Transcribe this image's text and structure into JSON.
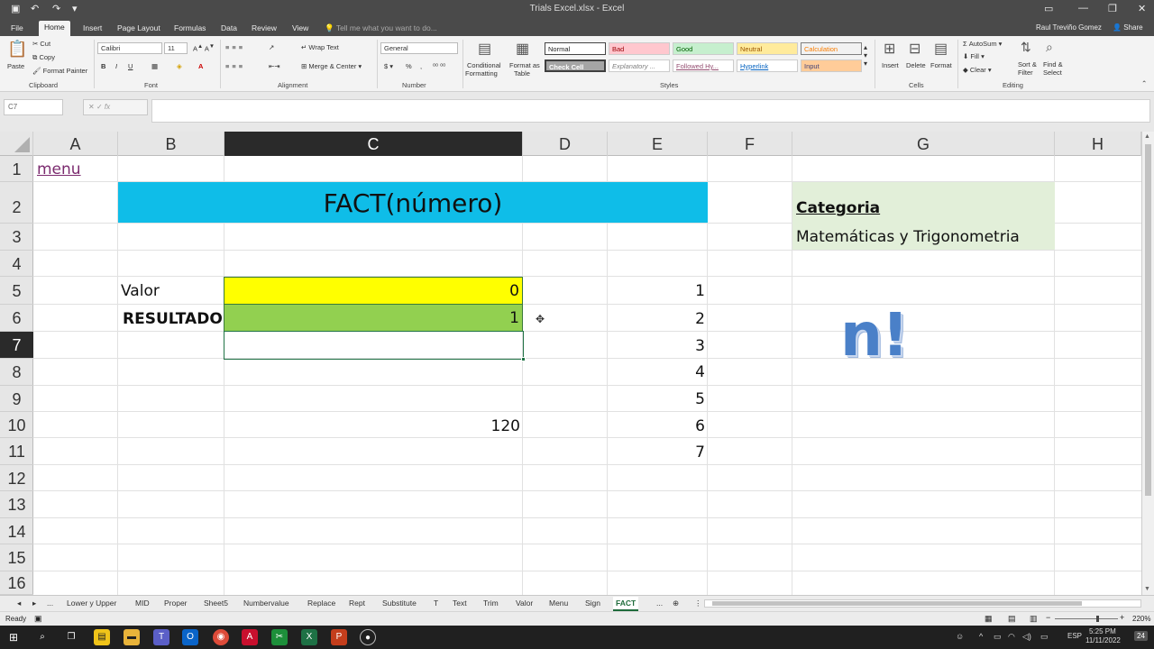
{
  "window": {
    "title": "Trials Excel.xlsx - Excel",
    "user": "Raul Treviño Gomez",
    "share": "Share"
  },
  "ribbon_tabs": [
    "File",
    "Home",
    "Insert",
    "Page Layout",
    "Formulas",
    "Data",
    "Review",
    "View"
  ],
  "tell_me": "Tell me what you want to do...",
  "ribbon": {
    "clipboard": {
      "paste": "Paste",
      "cut": "Cut",
      "copy": "Copy",
      "format_painter": "Format Painter",
      "label": "Clipboard"
    },
    "font": {
      "name": "Calibri",
      "size": "11",
      "label": "Font"
    },
    "alignment": {
      "wrap": "Wrap Text",
      "merge": "Merge & Center",
      "label": "Alignment"
    },
    "number": {
      "format": "General",
      "label": "Number"
    },
    "cond": {
      "line1": "Conditional",
      "line2": "Formatting"
    },
    "fmt_table": {
      "line1": "Format as",
      "line2": "Table"
    },
    "styles": {
      "normal": "Normal",
      "bad": "Bad",
      "good": "Good",
      "neutral": "Neutral",
      "calculation": "Calculation",
      "check": "Check Cell",
      "explanatory": "Explanatory ...",
      "followed": "Followed Hy...",
      "hyperlink": "Hyperlink",
      "input": "Input",
      "label": "Styles"
    },
    "cells": {
      "insert": "Insert",
      "delete": "Delete",
      "format": "Format",
      "label": "Cells"
    },
    "editing": {
      "autosum": "AutoSum",
      "fill": "Fill",
      "clear": "Clear",
      "sort1": "Sort &",
      "sort2": "Filter",
      "find1": "Find &",
      "find2": "Select",
      "label": "Editing"
    }
  },
  "namebox": "C7",
  "columns": [
    "A",
    "B",
    "C",
    "D",
    "E",
    "F",
    "G",
    "H"
  ],
  "rows": [
    "1",
    "2",
    "3",
    "4",
    "5",
    "6",
    "7",
    "8",
    "9",
    "10",
    "11",
    "12",
    "13",
    "14",
    "15",
    "16"
  ],
  "cells": {
    "a1": "menu",
    "title": "FACT(número)",
    "categoria_label": "Categoria",
    "categoria_value": "Matemáticas y Trigonometria",
    "valor_label": "Valor",
    "valor_value": "0",
    "resultado_label": "RESULTADO",
    "resultado_value": "1",
    "c10": "120",
    "e_values": [
      "1",
      "2",
      "3",
      "4",
      "5",
      "6",
      "7"
    ],
    "nfact": "n!"
  },
  "sheets": [
    "...",
    "Lower y Upper",
    "MID",
    "Proper",
    "Sheet5",
    "Numbervalue",
    "Replace",
    "Rept",
    "Substitute",
    "T",
    "Text",
    "Trim",
    "Valor",
    "Menu",
    "Sign",
    "FACT",
    "..."
  ],
  "active_sheet": "FACT",
  "status": {
    "ready": "Ready",
    "zoom": "220%"
  },
  "taskbar": {
    "lang": "ESP",
    "time": "5:25 PM",
    "date": "11/11/2022",
    "notif": "24"
  },
  "colors": {
    "title_bg": "#0fbde8",
    "categoria_bg": "#e2efd9",
    "valor_bg": "#ffff00",
    "resultado_bg": "#92d050",
    "nfact_fill": "#4a80c8"
  }
}
